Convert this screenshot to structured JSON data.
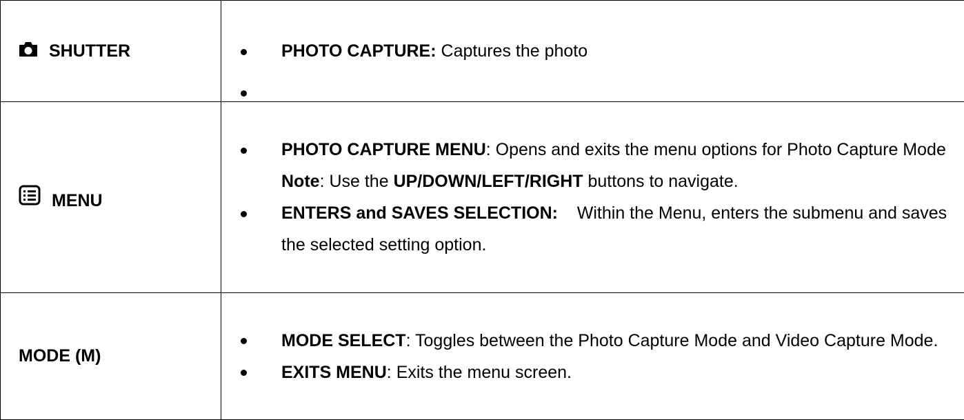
{
  "rows": {
    "shutter": {
      "label": "SHUTTER",
      "icon": "camera-icon",
      "bullets": [
        {
          "bold": "PHOTO CAPTURE:",
          "text": " Captures the photo"
        },
        {
          "bold": "",
          "text": ""
        }
      ]
    },
    "menu": {
      "label": "MENU",
      "icon": "menu-list-icon",
      "bullet1_bold": "PHOTO CAPTURE MENU",
      "bullet1_text": ": Opens and exits the menu options for Photo Capture Mode",
      "note_bold": "Note",
      "note_text1": ": Use the ",
      "note_bold2": "UP/DOWN/LEFT/RIGHT",
      "note_text2": " buttons to navigate.",
      "bullet2_bold": "ENTERS and SAVES SELECTION:",
      "bullet2_text": "    Within the Menu, enters the submenu and saves the selected setting option."
    },
    "mode": {
      "label": "MODE (M)",
      "bullet1_bold": "MODE SELECT",
      "bullet1_text": ": Toggles between the Photo Capture Mode and Video Capture Mode.",
      "bullet2_bold": "EXITS MENU",
      "bullet2_text": ": Exits the menu screen."
    }
  }
}
